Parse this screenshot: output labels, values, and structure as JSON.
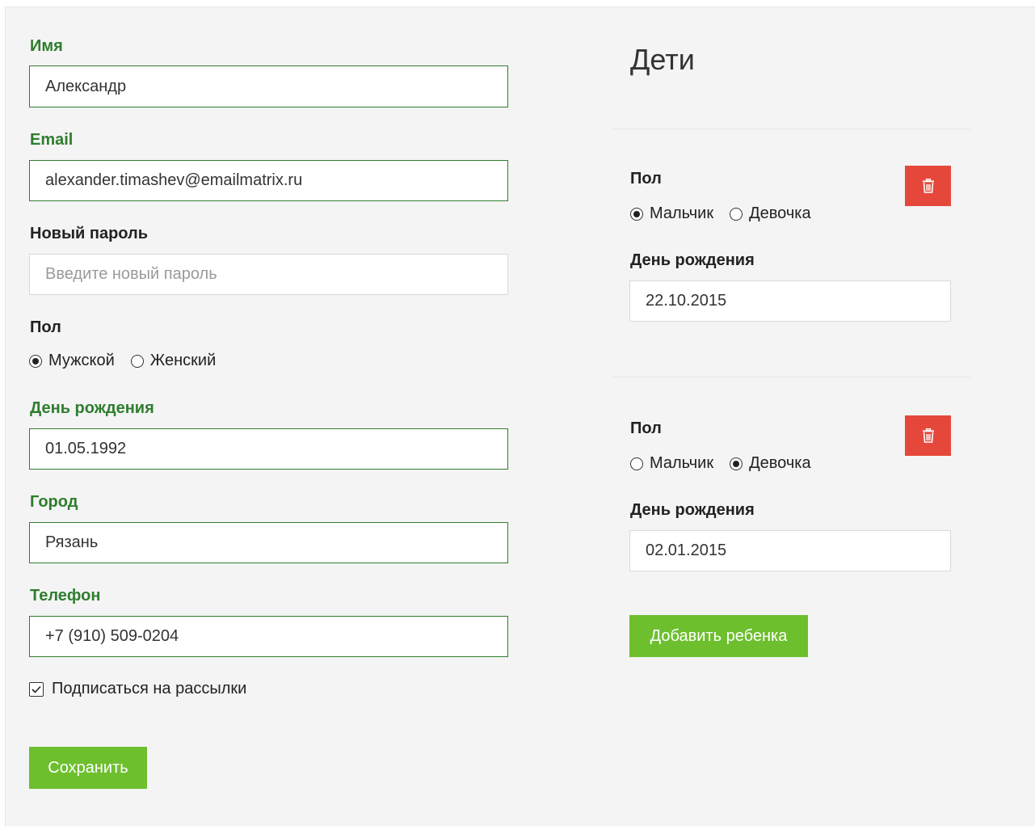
{
  "profile": {
    "name": {
      "label": "Имя",
      "value": "Александр"
    },
    "email": {
      "label": "Email",
      "value": "alexander.timashev@emailmatrix.ru"
    },
    "password": {
      "label": "Новый пароль",
      "value": "",
      "placeholder": "Введите новый пароль"
    },
    "gender": {
      "label": "Пол",
      "options": [
        "Мужской",
        "Женский"
      ],
      "selected": "Мужской"
    },
    "birthday": {
      "label": "День рождения",
      "value": "01.05.1992"
    },
    "city": {
      "label": "Город",
      "value": "Рязань"
    },
    "phone": {
      "label": "Телефон",
      "value": "+7 (910) 509-0204"
    },
    "subscribe": {
      "label": "Подписаться на рассылки",
      "checked": true
    },
    "save_label": "Сохранить"
  },
  "children": {
    "heading": "Дети",
    "items": [
      {
        "gender_label": "Пол",
        "options": [
          "Мальчик",
          "Девочка"
        ],
        "selected": "Мальчик",
        "birthday_label": "День рождения",
        "birthday": "22.10.2015"
      },
      {
        "gender_label": "Пол",
        "options": [
          "Мальчик",
          "Девочка"
        ],
        "selected": "Девочка",
        "birthday_label": "День рождения",
        "birthday": "02.01.2015"
      }
    ],
    "add_label": "Добавить ребенка"
  },
  "colors": {
    "valid_label": "#2f7d2f",
    "button_green": "#6dbf2e",
    "button_red": "#e5483b",
    "panel_background": "#f4f4f4"
  },
  "icons": {
    "delete": "trash-icon",
    "checkbox": "checkmark-icon"
  }
}
